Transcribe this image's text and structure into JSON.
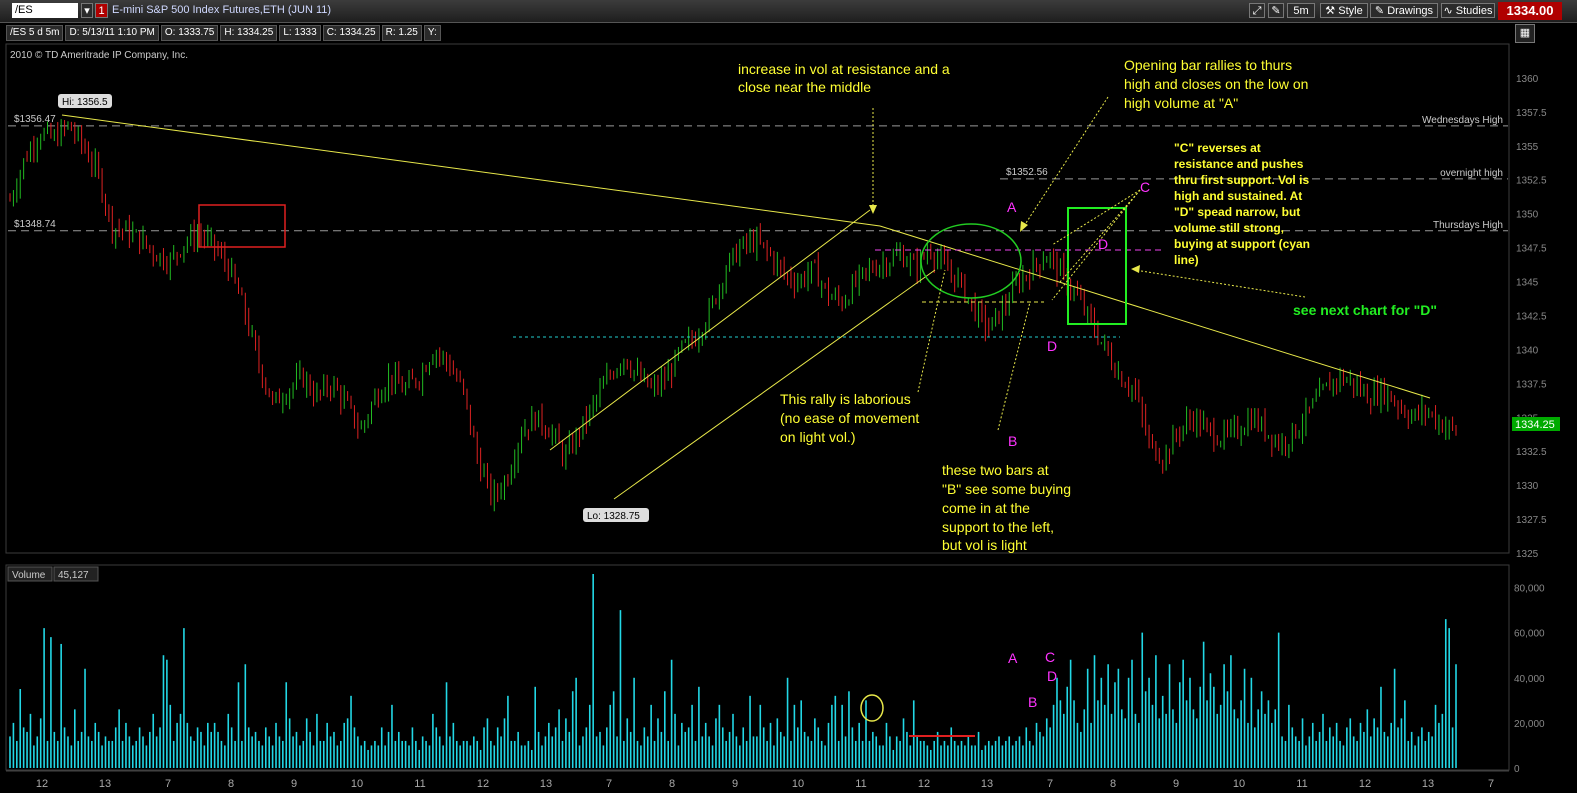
{
  "toolbar": {
    "symbol": "/ES",
    "badge": "1",
    "title": "E-mini S&P 500 Index Futures,ETH (JUN 11)",
    "timeframe": "5m",
    "style_label": "Style",
    "drawings_label": "Drawings",
    "studies_label": "Studies",
    "last_price": "1334.00"
  },
  "info": {
    "period": "/ES 5 d 5m",
    "date": "D: 5/13/11 1:10 PM",
    "open": "O: 1333.75",
    "high": "H: 1334.25",
    "low": "L: 1333",
    "close": "C: 1334.25",
    "range": "R: 1.25",
    "y": "Y:"
  },
  "copyright": "2010 © TD Ameritrade IP Company, Inc.",
  "volume_panel": {
    "label": "Volume",
    "value": "45,127"
  },
  "price_tag": "1334.25",
  "chart_data": [
    {
      "type": "candlestick",
      "ylim": [
        1325,
        1362.5
      ],
      "y_ticks": [
        "1325",
        "1327.5",
        "1330",
        "1332.5",
        "1335",
        "1337.5",
        "1340",
        "1342.5",
        "1345",
        "1347.5",
        "1350",
        "1352.5",
        "1355",
        "1357.5",
        "1360"
      ],
      "x_ticks": [
        "12",
        "13",
        "7",
        "8",
        "9",
        "10",
        "11",
        "12",
        "13",
        "7",
        "8",
        "9",
        "10",
        "11",
        "12",
        "13",
        "7",
        "8",
        "9",
        "10",
        "11",
        "12",
        "13",
        "7"
      ],
      "path": [
        1351,
        1354,
        1356,
        1355.5,
        1356.5,
        1355,
        1353,
        1349,
        1348.7,
        1348,
        1347,
        1346.5,
        1348,
        1348.5,
        1347.5,
        1346,
        1343,
        1339,
        1336,
        1337,
        1338,
        1336.5,
        1337.5,
        1336,
        1334,
        1336.5,
        1338,
        1337,
        1338,
        1340,
        1339,
        1337,
        1332,
        1329,
        1330.5,
        1334,
        1335,
        1334,
        1332,
        1334,
        1336,
        1338,
        1339.5,
        1338,
        1337,
        1338,
        1340,
        1341,
        1343,
        1346,
        1347.5,
        1348,
        1347,
        1345.5,
        1345,
        1346,
        1344,
        1343.5,
        1345,
        1346,
        1346.5,
        1347,
        1346,
        1347.5,
        1346,
        1345,
        1343,
        1341.5,
        1343,
        1345,
        1346,
        1347,
        1345.5,
        1344,
        1342,
        1340,
        1338,
        1337,
        1333,
        1332,
        1334,
        1335,
        1334,
        1333.5,
        1334,
        1335,
        1334,
        1333,
        1334,
        1335.5,
        1337,
        1338,
        1337.5,
        1336.5,
        1337,
        1336,
        1335,
        1335.5,
        1334.5,
        1334
      ],
      "hlines": [
        {
          "value": 1356.47,
          "label": "$1356.47",
          "right_label": "Wednesdays High"
        },
        {
          "value": 1352.56,
          "label": "$1352.56",
          "right_label": "overnight high"
        },
        {
          "value": 1348.74,
          "label": "$1348.74",
          "right_label": "Thursdays High"
        }
      ],
      "high_label": "Hi: 1356.5",
      "low_label": "Lo: 1328.75",
      "annotations": [
        "increase in vol at resistance and a",
        "close near the middle",
        "Opening bar rallies to thurs",
        "high and closes on the low on",
        "high volume at \"A\"",
        "\"C\" reverses at",
        "resistance and pushes",
        "thru first support.  Vol is",
        "high and sustained.  At",
        "\"D\" spead narrow, but",
        "volume still strong,",
        "buying at support (cyan",
        "line)",
        "see next chart for \"D\"",
        "This rally is laborious",
        "(no ease of movement",
        "on light vol.)",
        "these two bars at",
        "\"B\" see some buying",
        "come in at the",
        "support to the left,",
        "but vol is light"
      ],
      "markers": [
        "A",
        "B",
        "C",
        "D",
        "D"
      ]
    },
    {
      "type": "bar",
      "name": "Volume",
      "ylim": [
        0,
        90000
      ],
      "y_ticks": [
        "0",
        "20,000",
        "40,000",
        "60,000",
        "80,000"
      ],
      "volumes": [
        14,
        20,
        12,
        35,
        18,
        16,
        24,
        10,
        14,
        22,
        62,
        12,
        58,
        16,
        12,
        55,
        18,
        14,
        10,
        26,
        12,
        16,
        44,
        14,
        12,
        20,
        16,
        10,
        14,
        12,
        12,
        18,
        26,
        12,
        20,
        14,
        10,
        12,
        18,
        14,
        10,
        16,
        24,
        14,
        18,
        50,
        48,
        28,
        12,
        20,
        24,
        62,
        20,
        14,
        12,
        18,
        16,
        10,
        20,
        16,
        20,
        16,
        12,
        10,
        24,
        18,
        12,
        38,
        12,
        46,
        18,
        14,
        16,
        12,
        10,
        18,
        14,
        10,
        20,
        14,
        12,
        38,
        22,
        14,
        16,
        10,
        12,
        22,
        16,
        10,
        24,
        12,
        12,
        20,
        14,
        16,
        10,
        12,
        20,
        22,
        32,
        18,
        14,
        10,
        12,
        8,
        10,
        12,
        10,
        18,
        10,
        16,
        28,
        12,
        16,
        12,
        12,
        10,
        18,
        12,
        8,
        14,
        12,
        10,
        24,
        18,
        14,
        10,
        38,
        14,
        20,
        12,
        10,
        12,
        12,
        10,
        14,
        12,
        8,
        18,
        22,
        12,
        10,
        18,
        14,
        22,
        32,
        12,
        12,
        16,
        10,
        10,
        12,
        8,
        36,
        16,
        10,
        14,
        20,
        14,
        18,
        26,
        12,
        22,
        16,
        34,
        40,
        10,
        14,
        18,
        28,
        86,
        14,
        16,
        10,
        18,
        28,
        34,
        14,
        70,
        12,
        22,
        16,
        40,
        12,
        10,
        18,
        14,
        28,
        12,
        22,
        16,
        34,
        12,
        48,
        24,
        10,
        20,
        16,
        18,
        28,
        12,
        36,
        14,
        20,
        14,
        10,
        22,
        28,
        18,
        12,
        16,
        24,
        14,
        10,
        18,
        12,
        32,
        14,
        14,
        28,
        18,
        12,
        20,
        10,
        22,
        16,
        14,
        40,
        12,
        28,
        18,
        30,
        16,
        14,
        12,
        22,
        18,
        12,
        10,
        20,
        28,
        32,
        12,
        28,
        14,
        34,
        18,
        12,
        20,
        12,
        30,
        12,
        16,
        14,
        10,
        10,
        20,
        14,
        8,
        14,
        12,
        22,
        16,
        10,
        30,
        14,
        12,
        12,
        10,
        8,
        12,
        16,
        10,
        12,
        10,
        18,
        12,
        10,
        12,
        10,
        14,
        10,
        10,
        16,
        8,
        10,
        12,
        10,
        12,
        14,
        10,
        12,
        14,
        10,
        12,
        14,
        10,
        18,
        12,
        10,
        20,
        16,
        14,
        22,
        18,
        28,
        40,
        30,
        24,
        36,
        48,
        30,
        20,
        16,
        26,
        44,
        20,
        50,
        30,
        40,
        28,
        46,
        24,
        38,
        44,
        26,
        22,
        40,
        48,
        24,
        20,
        60,
        34,
        40,
        28,
        50,
        22,
        32,
        24,
        46,
        26,
        20,
        38,
        48,
        30,
        40,
        26,
        22,
        36,
        56,
        30,
        42,
        36,
        24,
        28,
        46,
        34,
        50,
        26,
        22,
        30,
        44,
        20,
        40,
        18,
        26,
        34,
        24,
        30,
        20,
        26,
        60,
        14,
        12,
        28,
        18,
        14,
        12,
        22,
        10,
        14,
        20,
        12,
        16,
        24,
        12,
        18,
        14,
        20,
        12,
        10,
        18,
        22,
        14,
        12,
        20,
        16,
        26,
        14,
        22,
        18,
        36,
        16,
        14,
        20,
        44,
        18,
        22,
        30,
        12,
        16,
        10,
        14,
        18,
        12,
        16,
        14,
        28,
        20,
        24,
        66,
        62,
        18,
        46
      ]
    }
  ]
}
